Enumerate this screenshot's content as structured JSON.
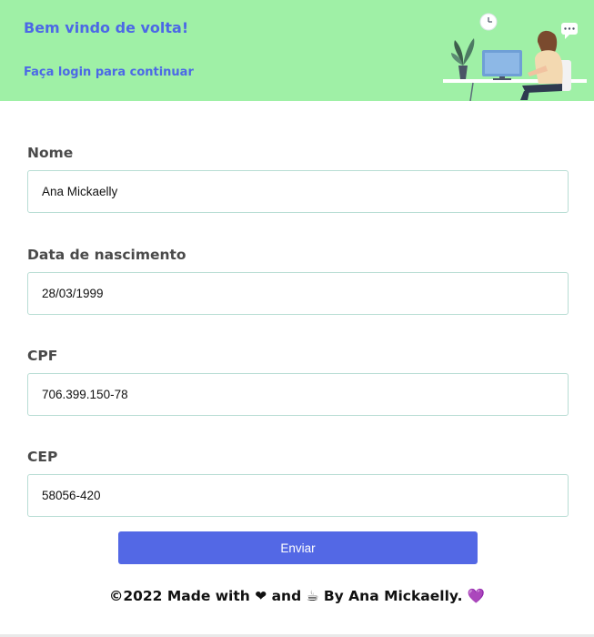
{
  "header": {
    "welcome": "Bem vindo de volta!",
    "subtitle": "Faça login para continuar"
  },
  "form": {
    "fields": [
      {
        "label": "Nome",
        "value": "Ana Mickaelly"
      },
      {
        "label": "Data de nascimento",
        "value": "28/03/1999"
      },
      {
        "label": "CPF",
        "value": "706.399.150-78"
      },
      {
        "label": "CEP",
        "value": "58056-420"
      }
    ],
    "submit_label": "Enviar"
  },
  "footer": {
    "text": "©2022 Made with ❤ and ☕ By Ana Mickaelly. 💜"
  },
  "colors": {
    "header_bg": "#9ff0a6",
    "accent": "#5368e5",
    "title_text": "#4c68e6"
  }
}
